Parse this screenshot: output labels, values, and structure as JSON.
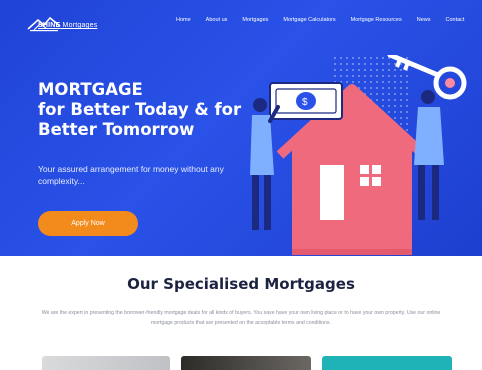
{
  "brand": {
    "name_bold": "SHINE",
    "name_rest": " Mortgages"
  },
  "nav": {
    "items": [
      "Home",
      "About us",
      "Mortgages",
      "Mortgage Calculators",
      "Mortgage Resources",
      "News",
      "Contact"
    ]
  },
  "hero": {
    "headline_line1": "MORTGAGE",
    "headline_line2": "for Better Today & for",
    "headline_line3": "Better Tomorrow",
    "subtext": "Your assured arrangement for money without any complexity...",
    "cta_label": "Apply Now"
  },
  "section": {
    "title": "Our Specialised Mortgages",
    "description": "We are the expert in presenting the borrower-friendly mortgage deals for all kinds of buyers. You save have your own living place or to have your own property. Use our online mortgage products that are presented on the acceptable terms and conditions."
  },
  "colors": {
    "hero_bg": "#2347d9",
    "cta": "#f28b1c",
    "house": "#f06a7e",
    "title": "#1b2340"
  },
  "icons": [
    "logo-house-icon",
    "money-bill-icon",
    "key-icon"
  ]
}
